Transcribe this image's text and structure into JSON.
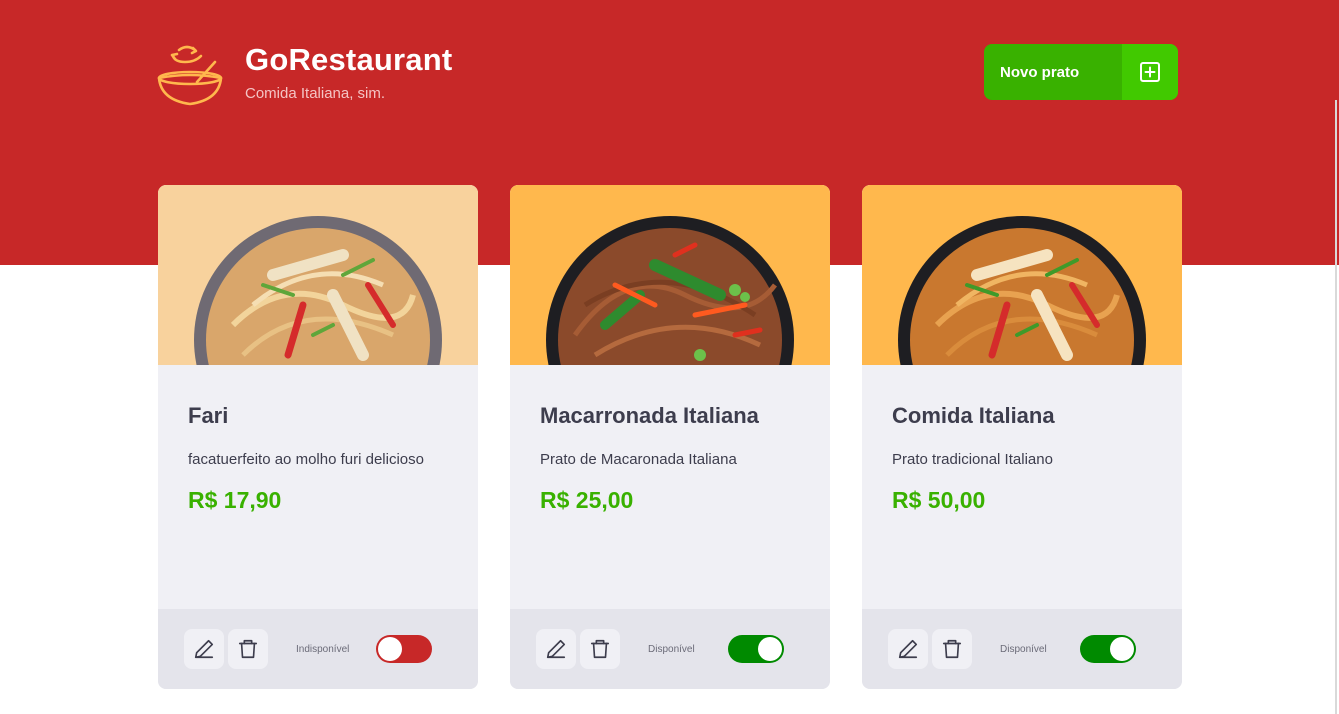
{
  "header": {
    "title": "GoRestaurant",
    "subtitle": "Comida Italiana, sim.",
    "new_button_label": "Novo prato",
    "logo_icon": "bowl-icon",
    "add_icon": "plus-square-icon"
  },
  "colors": {
    "brand_red": "#c72828",
    "accent_green": "#39b100",
    "toggle_on": "#008a00",
    "card_bg": "#f0f0f5",
    "card_footer": "#e4e4eb"
  },
  "dishes": [
    {
      "name": "Fari",
      "description": "facatuerfeito ao molho furi delicioso",
      "price": "R$ 17,90",
      "status": "Indisponível",
      "available": false,
      "image_bg": "#f8d29d"
    },
    {
      "name": "Macarronada Italiana",
      "description": "Prato de Macaronada Italiana",
      "price": "R$ 25,00",
      "status": "Disponível",
      "available": true,
      "image_bg": "#ffb84d"
    },
    {
      "name": "Comida Italiana",
      "description": "Prato tradicional Italiano",
      "price": "R$ 50,00",
      "status": "Disponível",
      "available": true,
      "image_bg": "#ffb84d"
    }
  ]
}
